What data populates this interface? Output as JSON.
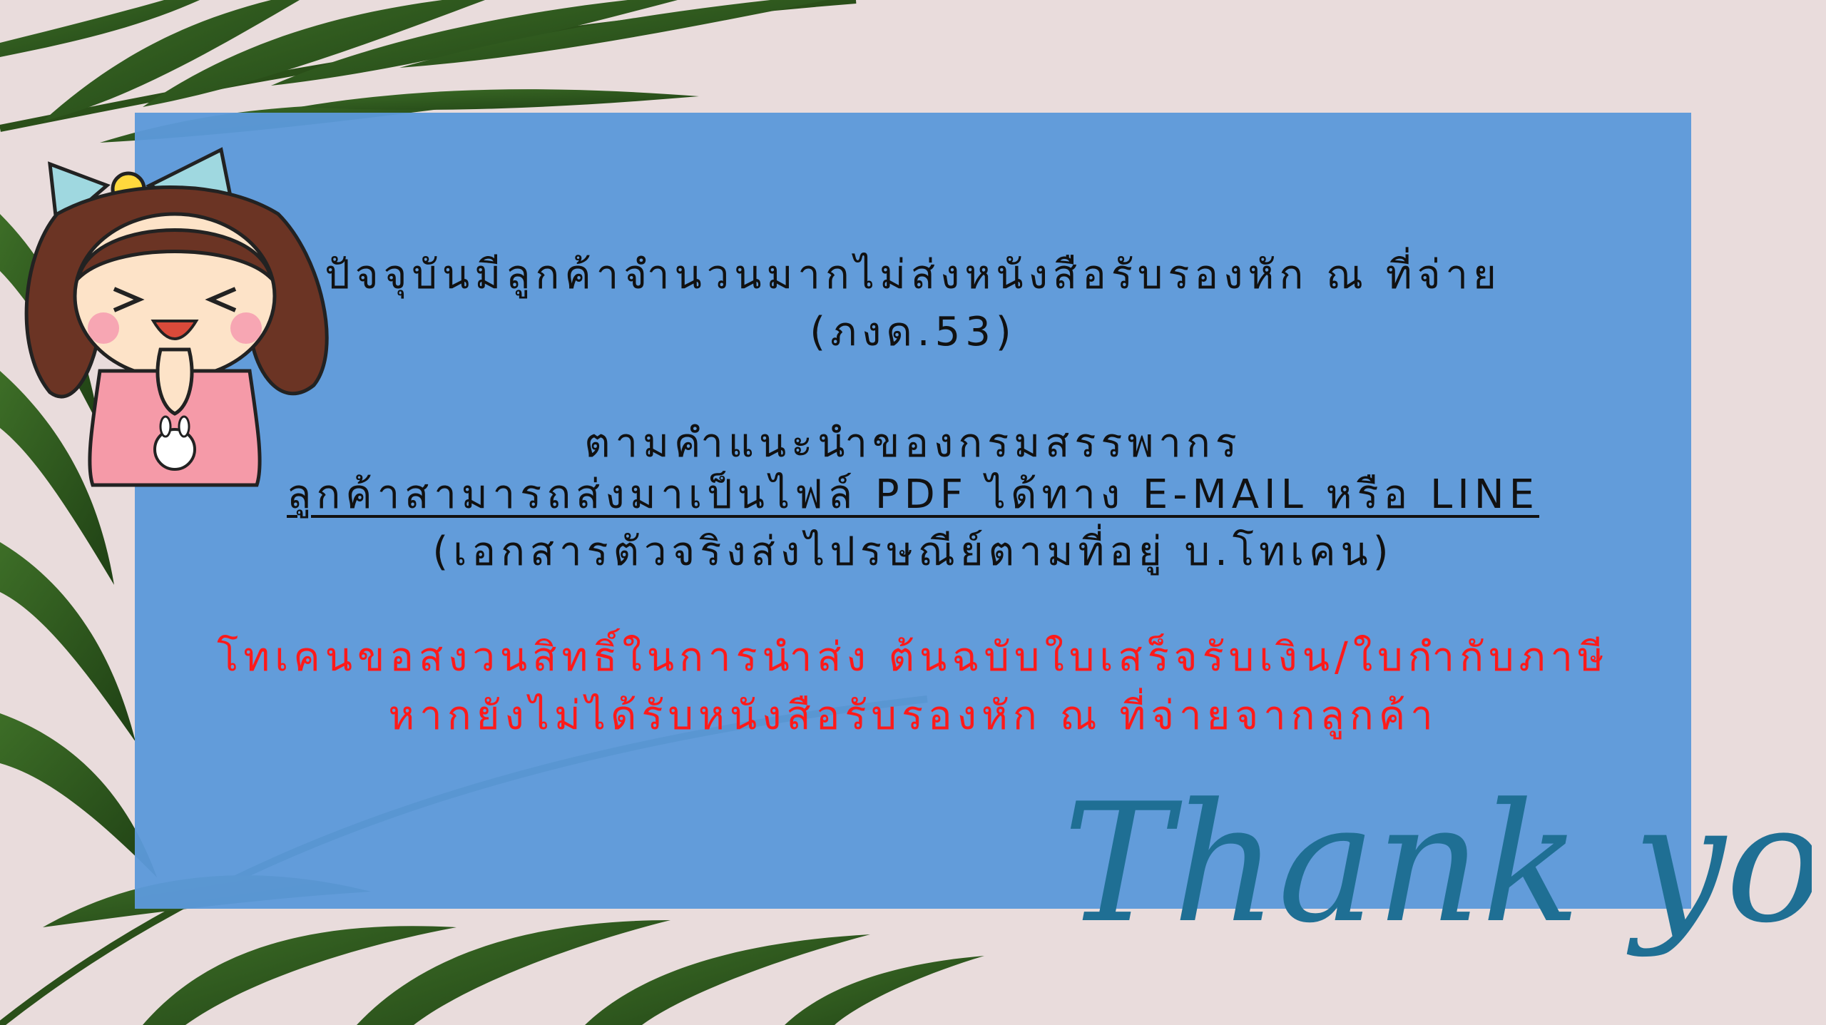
{
  "slide": {
    "line1": "ปัจจุบันมีลูกค้าจำนวนมากไม่ส่งหนังสือรับรองหัก ณ ที่จ่าย",
    "line2": "(ภงด.53)",
    "line3": "ตามคำแนะนำของกรมสรรพากร",
    "line4": "ลูกค้าสามารถส่งมาเป็นไฟล์ PDF ได้ทาง E-MAIL หรือ LINE",
    "line5": "(เอกสารตัวจริงส่งไปรษณีย์ตามที่อยู่ บ.โทเคน)",
    "line6": "โทเคนขอสงวนสิทธิ์ในการนำส่ง ต้นฉบับใบเสร็จรับเงิน/ใบกำกับภาษี",
    "line7": "หากยังไม่ได้รับหนังสือรับรองหัก ณ ที่จ่ายจากลูกค้า",
    "thank_you": "Thank you!"
  },
  "colors": {
    "panel": "#5c99da",
    "red_text": "#ff1a1a",
    "thank_you": "#1f6f94",
    "background": "#e9dcdc",
    "leaf": "#2f5b1e"
  },
  "icons": [
    "palm-leaf-illustration",
    "girl-greeting-illustration"
  ]
}
